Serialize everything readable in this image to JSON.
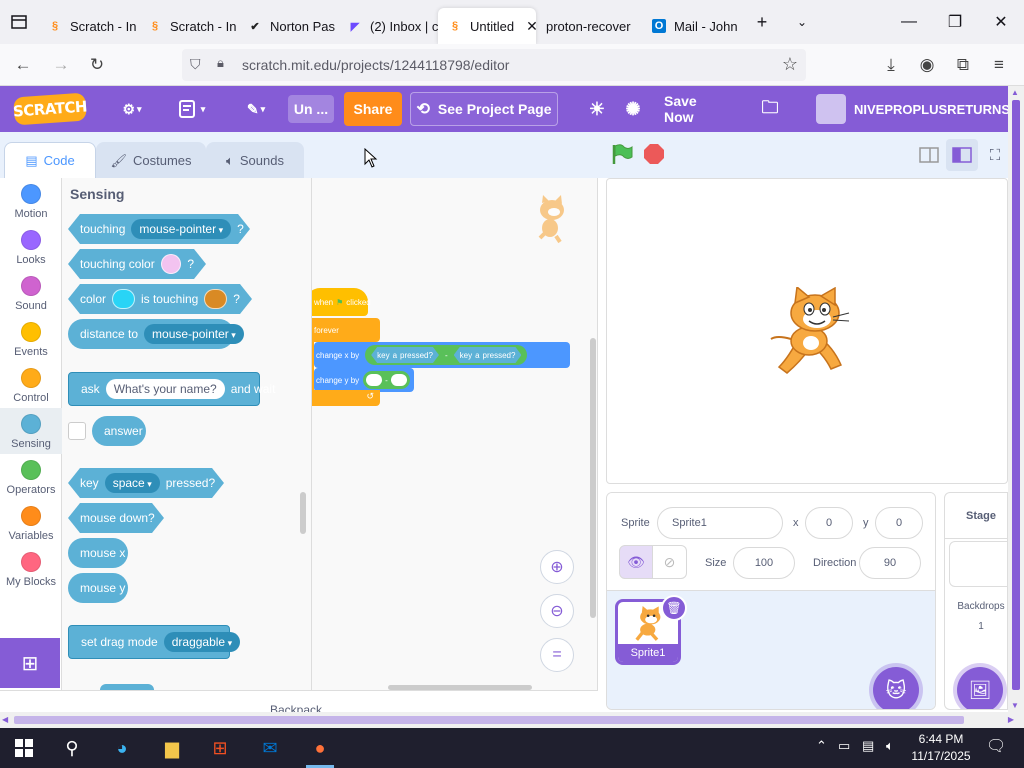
{
  "browser": {
    "tabs": [
      {
        "label": "Scratch - In",
        "icon": "scratch-favicon"
      },
      {
        "label": "Scratch - In",
        "icon": "scratch-favicon"
      },
      {
        "label": "Norton Pas",
        "icon": "norton-check-icon"
      },
      {
        "label": "(2) Inbox | c",
        "icon": "proton-mail-icon"
      },
      {
        "label": "Untitled",
        "icon": "scratch-favicon",
        "active": true
      },
      {
        "label": "proton-recover",
        "icon": "none"
      },
      {
        "label": "Mail - John",
        "icon": "outlook-icon"
      }
    ],
    "url": "scratch.mit.edu/projects/1244118798/editor"
  },
  "menubar": {
    "logo": "SCRATCH",
    "project_title": "Un ...",
    "share": "Share",
    "see_project_page": "See Project Page",
    "save_now": "Save Now",
    "username": "NIVEPROPLUSRETURNS"
  },
  "editor_tabs": {
    "code": "Code",
    "costumes": "Costumes",
    "sounds": "Sounds"
  },
  "categories": [
    {
      "label": "Motion",
      "color": "#4c97ff"
    },
    {
      "label": "Looks",
      "color": "#9966ff"
    },
    {
      "label": "Sound",
      "color": "#cf63cf"
    },
    {
      "label": "Events",
      "color": "#ffbf00"
    },
    {
      "label": "Control",
      "color": "#ffab19"
    },
    {
      "label": "Sensing",
      "color": "#5cb1d6"
    },
    {
      "label": "Operators",
      "color": "#59c059"
    },
    {
      "label": "Variables",
      "color": "#ff8c1a"
    },
    {
      "label": "My Blocks",
      "color": "#ff6680"
    }
  ],
  "palette": {
    "title": "Sensing",
    "touching": "touching",
    "touching_target": "mouse-pointer",
    "q": "?",
    "touching_color": "touching color",
    "color": "color",
    "is_touching": "is touching",
    "distance_to": "distance to",
    "distance_target": "mouse-pointer",
    "ask": "ask",
    "ask_prompt": "What's your name?",
    "and_wait": "and wait",
    "answer": "answer",
    "key": "key",
    "key_value": "space",
    "pressed": "pressed?",
    "mouse_down": "mouse down?",
    "mouse_x": "mouse x",
    "mouse_y": "mouse y",
    "set_drag_mode": "set drag mode",
    "drag_value": "draggable"
  },
  "script": {
    "when_flag": "when",
    "clicked": "clicked",
    "forever": "forever",
    "change_x": "change x by",
    "key": "key",
    "key_val": "a",
    "pressed": "pressed?",
    "minus": "-",
    "key2_val": "a",
    "change_y": "change y by"
  },
  "sprite_info": {
    "sprite_label": "Sprite",
    "sprite_name": "Sprite1",
    "x_label": "x",
    "x_value": "0",
    "y_label": "y",
    "y_value": "0",
    "size_label": "Size",
    "size_value": "100",
    "direction_label": "Direction",
    "direction_value": "90",
    "sprite_thumb_label": "Sprite1"
  },
  "stage_selector": {
    "title": "Stage",
    "backdrops_label": "Backdrops",
    "backdrops_count": "1"
  },
  "backpack": "Backpack",
  "taskbar": {
    "time": "6:44 PM",
    "date": "11/17/2025"
  }
}
